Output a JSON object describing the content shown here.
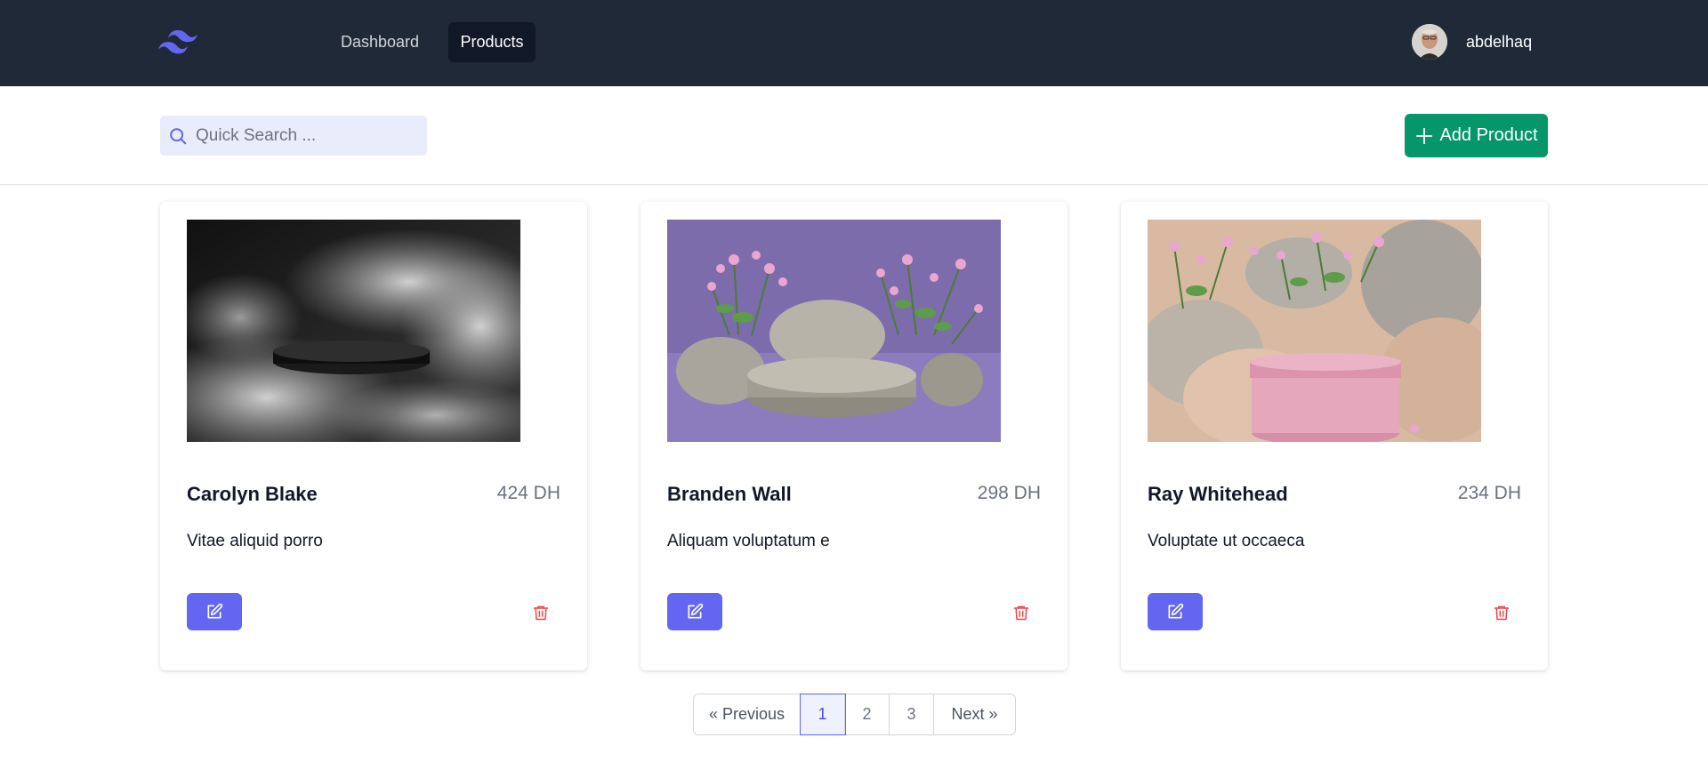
{
  "navbar": {
    "logo_icon": "tailwind-logo-icon",
    "links": [
      {
        "label": "Dashboard",
        "active": false
      },
      {
        "label": "Products",
        "active": true
      }
    ],
    "user": {
      "name": "abdelhaq",
      "avatar_icon": "user-avatar"
    }
  },
  "toolbar": {
    "search": {
      "placeholder": "Quick Search ...",
      "value": "",
      "icon": "search-icon"
    },
    "add_button": {
      "label": "Add Product",
      "icon": "plus-icon"
    }
  },
  "products": [
    {
      "name": "Carolyn Blake",
      "price": "424 DH",
      "description": "Vitae aliquid porro",
      "image": "smoky-black-podium"
    },
    {
      "name": "Branden Wall",
      "price": "298 DH",
      "description": "Aliquam voluptatum e",
      "image": "stone-podium-purple-flowers"
    },
    {
      "name": "Ray Whitehead",
      "price": "234 DH",
      "description": "Voluptate ut occaeca",
      "image": "pink-jar-rocks-flowers"
    }
  ],
  "pagination": {
    "previous": "« Previous",
    "pages": [
      "1",
      "2",
      "3"
    ],
    "current": "1",
    "next": "Next »"
  },
  "colors": {
    "navbar_bg": "#1f2937",
    "accent_indigo": "#6366f1",
    "add_green": "#059669",
    "delete_red": "#ef4444"
  }
}
